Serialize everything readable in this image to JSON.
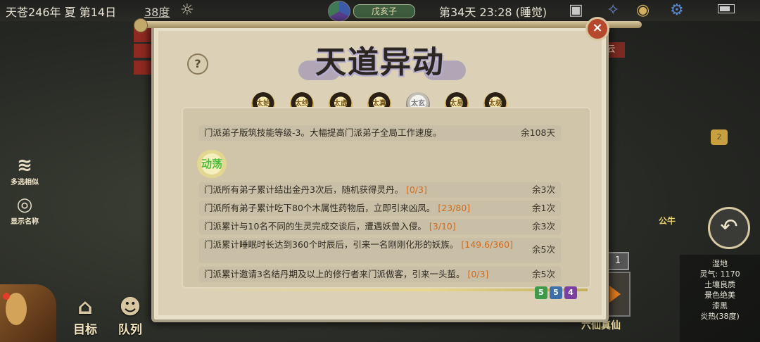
{
  "status_bar": {
    "date": "天苍246年 夏 第14日",
    "temperature": "38度",
    "sect_tag": "戊亥子",
    "time": "第34天 23:28 (睡觉)"
  },
  "sidebar": {
    "multi_select": "多选相似",
    "show_names": "显示名称"
  },
  "bottom_bar": {
    "target": "目标",
    "queue": "队列",
    "bagua": "六仙真仙"
  },
  "right_panel": {
    "chat_count": "2",
    "ox_label": "公牛",
    "queue_number": "1",
    "yun_tag": "云",
    "tile_info": [
      "湿地",
      "灵气: 1170",
      "土壤良质",
      "景色绝美",
      "漆黑",
      "炎热(38度)"
    ]
  },
  "modal": {
    "title": "天道异动",
    "help_label": "?",
    "close_label": "×",
    "tabs": [
      {
        "label": "太始",
        "selected": false
      },
      {
        "label": "太终",
        "selected": false
      },
      {
        "label": "太虚",
        "selected": false
      },
      {
        "label": "太真",
        "selected": false
      },
      {
        "label": "太玄",
        "selected": true
      },
      {
        "label": "太易",
        "selected": false
      },
      {
        "label": "太极",
        "selected": false
      }
    ],
    "effect": {
      "text": "门派弟子版筑技能等级-3。大幅提高门派弟子全局工作速度。",
      "remaining": "余108天"
    },
    "status_badge": "动荡",
    "conditions": [
      {
        "text": "门派所有弟子累计结出金丹3次后，随机获得灵丹。",
        "progress": "[0/3]",
        "remaining": "余3次"
      },
      {
        "text": "门派所有弟子累计吃下80个木属性药物后，立即引来凶凤。",
        "progress": "[23/80]",
        "remaining": "余1次"
      },
      {
        "text": "门派累计与10名不同的生灵完成交谈后，遭遇妖兽入侵。",
        "progress": "[3/10]",
        "remaining": "余3次"
      },
      {
        "text": "门派累计睡眠时长达到360个时辰后，引来一名刚刚化形的妖族。",
        "progress": "[149.6/360]",
        "remaining": "余5次"
      },
      {
        "text": "门派累计邀请3名结丹期及以上的修行者来门派做客，引来一头蜇。",
        "progress": "[0/3]",
        "remaining": "余5次"
      }
    ],
    "chips": [
      {
        "value": "5",
        "color": "#3f9a4a"
      },
      {
        "value": "5",
        "color": "#3f6fa8"
      },
      {
        "value": "4",
        "color": "#7a3fa0"
      }
    ]
  }
}
